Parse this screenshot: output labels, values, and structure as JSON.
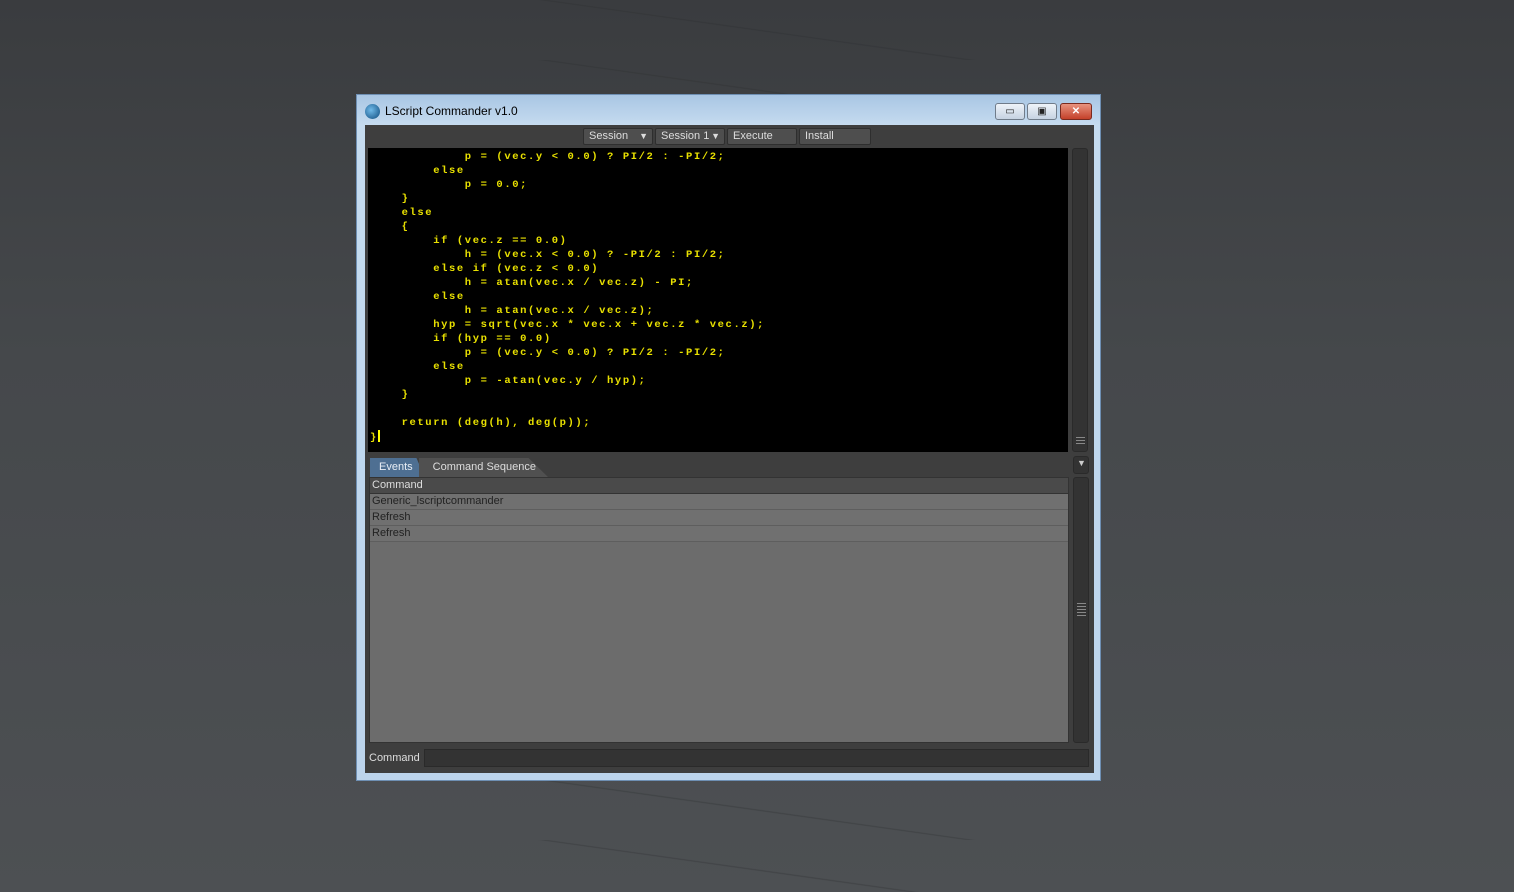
{
  "window": {
    "title": "LScript Commander v1.0",
    "minimize": "▭",
    "maximize": "▣",
    "close": "✕"
  },
  "toolbar": {
    "session_menu": "Session",
    "session_select": "Session 1",
    "execute": "Execute",
    "install": "Install"
  },
  "editor": {
    "lines": [
      "            p = (vec.y < 0.0) ? PI/2 : -PI/2;",
      "        else",
      "            p = 0.0;",
      "    }",
      "    else",
      "    {",
      "        if (vec.z == 0.0)",
      "            h = (vec.x < 0.0) ? -PI/2 : PI/2;",
      "        else if (vec.z < 0.0)",
      "            h = atan(vec.x / vec.z) - PI;",
      "        else",
      "            h = atan(vec.x / vec.z);",
      "        hyp = sqrt(vec.x * vec.x + vec.z * vec.z);",
      "        if (hyp == 0.0)",
      "            p = (vec.y < 0.0) ? PI/2 : -PI/2;",
      "        else",
      "            p = -atan(vec.y / hyp);",
      "    }",
      "",
      "    return (deg(h), deg(p));",
      "}"
    ],
    "text_color": "#e8e000"
  },
  "tabs": [
    {
      "label": "Events",
      "active": true
    },
    {
      "label": "Command Sequence",
      "active": false
    }
  ],
  "events": {
    "column": "Command",
    "rows": [
      "Generic_lscriptcommander",
      "Refresh",
      "Refresh"
    ]
  },
  "command": {
    "label": "Command",
    "value": ""
  }
}
